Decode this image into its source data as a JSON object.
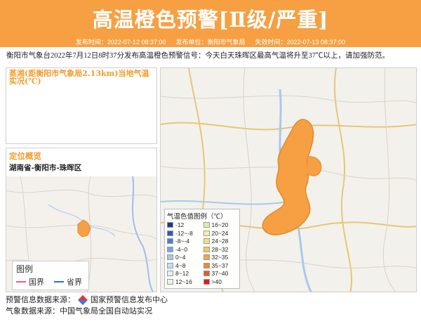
{
  "header": {
    "title": "高温橙色预警[Ⅱ级/严重]"
  },
  "meta": {
    "publish_time": "发布时间：2022-07-12 08:37:00",
    "publisher": "发布单位：衡阳市气象局",
    "expire_time": "失效时间：2022-07-13 08:37:00"
  },
  "notice": "衡阳市气象台2022年7月12日8时37分发布高温橙色预警信号：今天白天珠晖区最高气温将升至37℃以上，请加强防范。",
  "panel_temp": {
    "title": "蒸湘(距衡阳市气象局2.13km)当地气温实况(℃)"
  },
  "panel_location": {
    "title": "定位概览",
    "location": "湖南省-衡阳市-珠晖区",
    "legend": {
      "title": "图例",
      "country_border": "国界",
      "province_border": "省界"
    },
    "colors": {
      "country": "#e06080",
      "province": "#2f6ad8"
    }
  },
  "temp_legend": {
    "title": "气温色值图例（℃）",
    "items": [
      {
        "label": "-12",
        "color": "#1a3a8a"
      },
      {
        "label": "16~20",
        "color": "#d7f2a8"
      },
      {
        "label": "-12~-8",
        "color": "#2c5cb8"
      },
      {
        "label": "20~24",
        "color": "#f2f2a0"
      },
      {
        "label": "-8~-4",
        "color": "#4a7fd6"
      },
      {
        "label": "24~28",
        "color": "#f7e07a"
      },
      {
        "label": "-4~0",
        "color": "#76a6e6"
      },
      {
        "label": "28~32",
        "color": "#f9c65e"
      },
      {
        "label": "0~4",
        "color": "#a5c6f0"
      },
      {
        "label": "32~35",
        "color": "#f7a544"
      },
      {
        "label": "4~8",
        "color": "#c6dcf4"
      },
      {
        "label": "35~37",
        "color": "#f38a2e"
      },
      {
        "label": "8~12",
        "color": "#def0f4"
      },
      {
        "label": "37~40",
        "color": "#e85a1f"
      },
      {
        "label": "12~16",
        "color": "#eaf6e4"
      },
      {
        "label": ">40",
        "color": "#d42020"
      }
    ]
  },
  "footer": {
    "source_label": "预警信息数据来源：",
    "source_name": "国家预警信息发布中心",
    "weather_source": "气象数据来源：中国气象局全国自动站实况"
  }
}
